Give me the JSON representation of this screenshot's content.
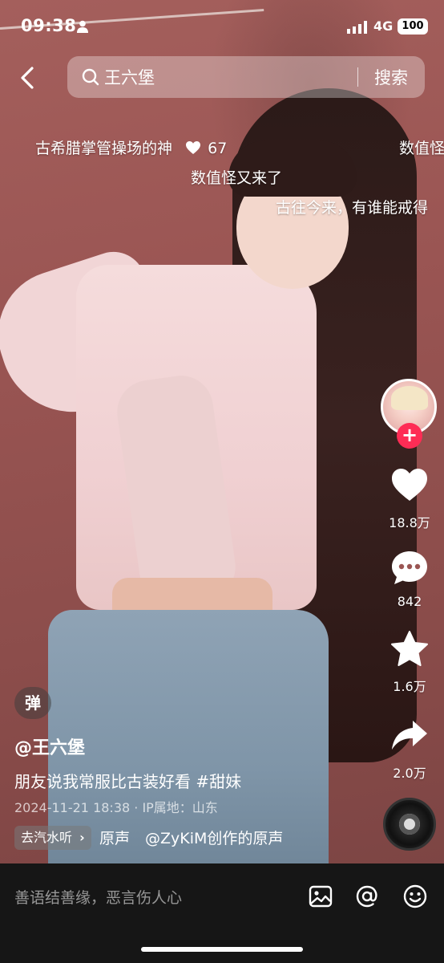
{
  "status_bar": {
    "time": "09:38",
    "network": "4G",
    "battery": "100"
  },
  "search": {
    "query": "王六堡",
    "button": "搜索"
  },
  "danmaku": [
    {
      "text": "古希腊掌管操场的神"
    },
    {
      "text": "67"
    },
    {
      "text": "数值怪"
    },
    {
      "text": "数值怪又来了"
    },
    {
      "text": "古往今来，有谁能戒得"
    }
  ],
  "rail": {
    "likes": "18.8万",
    "comments": "842",
    "favorites": "1.6万",
    "shares": "2.0万"
  },
  "video_info": {
    "danmaku_toggle": "弹",
    "author": "@王六堡",
    "description": "朋友说我常服比古装好看 #甜妹",
    "date_location": "2024-11-21 18:38 · IP属地：山东",
    "tag": "去汽水听",
    "music": "原声　@ZyKiM创作的原声"
  },
  "comment_bar": {
    "placeholder": "善语结善缘，恶言伤人心"
  },
  "colors": {
    "follow": "#fe2c55",
    "bar": "#161616"
  }
}
